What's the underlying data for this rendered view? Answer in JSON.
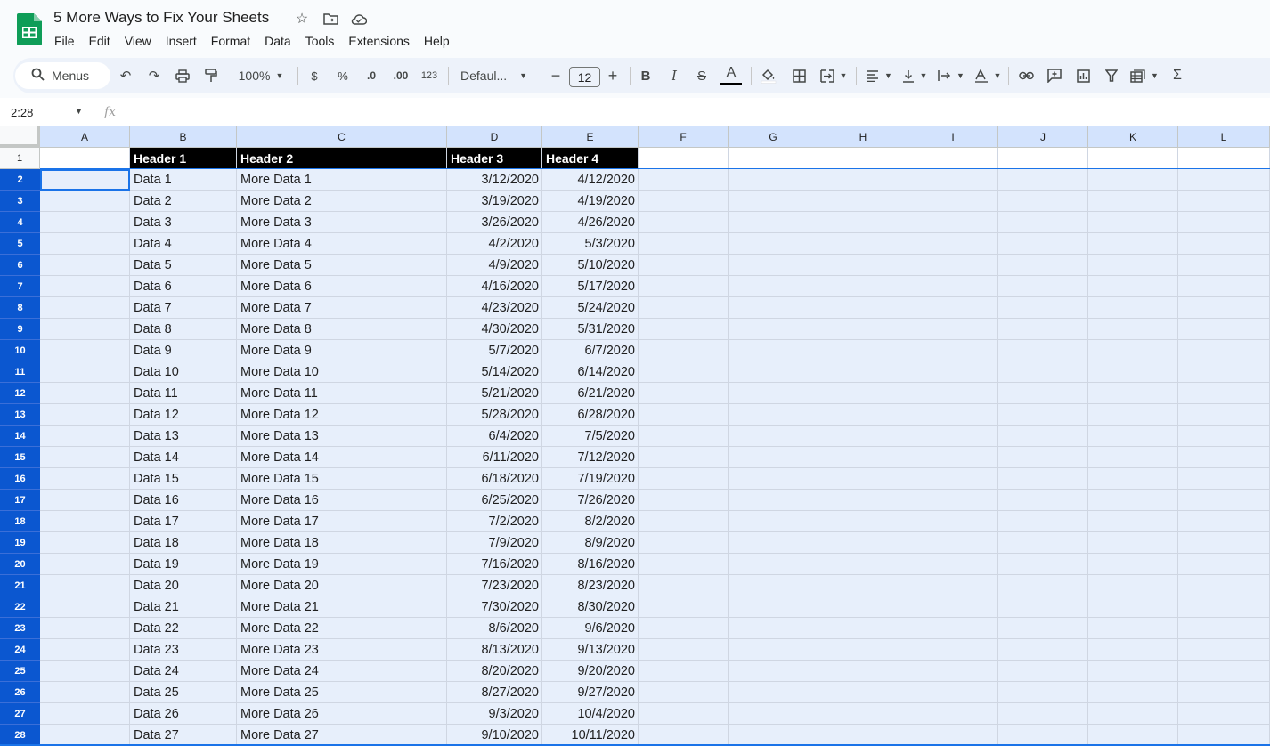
{
  "doc": {
    "title": "5 More Ways to Fix Your Sheets"
  },
  "menu": [
    "File",
    "Edit",
    "View",
    "Insert",
    "Format",
    "Data",
    "Tools",
    "Extensions",
    "Help"
  ],
  "toolbar": {
    "search_label": "Menus",
    "zoom": "100%",
    "currency": "$",
    "percent": "%",
    "dec_decrease": ".0",
    "dec_increase": ".00",
    "number_format": "123",
    "font": "Defaul...",
    "font_size": "12"
  },
  "formula_bar": {
    "name_box": "2:28",
    "fx": "fx"
  },
  "columns": [
    "A",
    "B",
    "C",
    "D",
    "E",
    "F",
    "G",
    "H",
    "I",
    "J",
    "K",
    "L"
  ],
  "rows": [
    "1",
    "2",
    "3",
    "4",
    "5",
    "6",
    "7",
    "8",
    "9",
    "10",
    "11",
    "12",
    "13",
    "14",
    "15",
    "16",
    "17",
    "18",
    "19",
    "20",
    "21",
    "22",
    "23",
    "24",
    "25",
    "26",
    "27",
    "28"
  ],
  "headers": [
    "Header 1",
    "Header 2",
    "Header 3",
    "Header 4"
  ],
  "data": [
    [
      "Data 1",
      "More Data 1",
      "3/12/2020",
      "4/12/2020"
    ],
    [
      "Data 2",
      "More Data 2",
      "3/19/2020",
      "4/19/2020"
    ],
    [
      "Data 3",
      "More Data 3",
      "3/26/2020",
      "4/26/2020"
    ],
    [
      "Data 4",
      "More Data 4",
      "4/2/2020",
      "5/3/2020"
    ],
    [
      "Data 5",
      "More Data 5",
      "4/9/2020",
      "5/10/2020"
    ],
    [
      "Data 6",
      "More Data 6",
      "4/16/2020",
      "5/17/2020"
    ],
    [
      "Data 7",
      "More Data 7",
      "4/23/2020",
      "5/24/2020"
    ],
    [
      "Data 8",
      "More Data 8",
      "4/30/2020",
      "5/31/2020"
    ],
    [
      "Data 9",
      "More Data 9",
      "5/7/2020",
      "6/7/2020"
    ],
    [
      "Data 10",
      "More Data 10",
      "5/14/2020",
      "6/14/2020"
    ],
    [
      "Data 11",
      "More Data 11",
      "5/21/2020",
      "6/21/2020"
    ],
    [
      "Data 12",
      "More Data 12",
      "5/28/2020",
      "6/28/2020"
    ],
    [
      "Data 13",
      "More Data 13",
      "6/4/2020",
      "7/5/2020"
    ],
    [
      "Data 14",
      "More Data 14",
      "6/11/2020",
      "7/12/2020"
    ],
    [
      "Data 15",
      "More Data 15",
      "6/18/2020",
      "7/19/2020"
    ],
    [
      "Data 16",
      "More Data 16",
      "6/25/2020",
      "7/26/2020"
    ],
    [
      "Data 17",
      "More Data 17",
      "7/2/2020",
      "8/2/2020"
    ],
    [
      "Data 18",
      "More Data 18",
      "7/9/2020",
      "8/9/2020"
    ],
    [
      "Data 19",
      "More Data 19",
      "7/16/2020",
      "8/16/2020"
    ],
    [
      "Data 20",
      "More Data 20",
      "7/23/2020",
      "8/23/2020"
    ],
    [
      "Data 21",
      "More Data 21",
      "7/30/2020",
      "8/30/2020"
    ],
    [
      "Data 22",
      "More Data 22",
      "8/6/2020",
      "9/6/2020"
    ],
    [
      "Data 23",
      "More Data 23",
      "8/13/2020",
      "9/13/2020"
    ],
    [
      "Data 24",
      "More Data 24",
      "8/20/2020",
      "9/20/2020"
    ],
    [
      "Data 25",
      "More Data 25",
      "8/27/2020",
      "9/27/2020"
    ],
    [
      "Data 26",
      "More Data 26",
      "9/3/2020",
      "10/4/2020"
    ],
    [
      "Data 27",
      "More Data 27",
      "9/10/2020",
      "10/11/2020"
    ]
  ],
  "colors": {
    "accent": "#0b57d0",
    "selection": "#e7effb",
    "header_fill": "#000000",
    "sheets_green": "#0f9d58"
  }
}
